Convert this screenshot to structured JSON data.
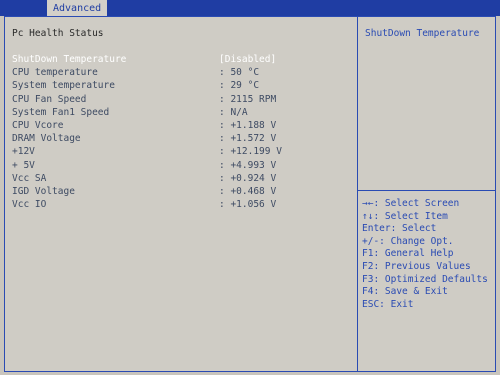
{
  "tabs": {
    "active_label": "Advanced"
  },
  "main": {
    "title": "Pc Health Status",
    "rows": [
      {
        "label": "ShutDown Temperature",
        "value": "[Disabled]"
      },
      {
        "label": "CPU temperature",
        "value": ": 50 °C"
      },
      {
        "label": "System temperature",
        "value": ": 29 °C"
      },
      {
        "label": "CPU Fan Speed",
        "value": ": 2115 RPM"
      },
      {
        "label": "System Fan1 Speed",
        "value": ": N/A"
      },
      {
        "label": "CPU Vcore",
        "value": ": +1.188 V"
      },
      {
        "label": "DRAM Voltage",
        "value": ": +1.572 V"
      },
      {
        "label": "+12V",
        "value": ": +12.199 V"
      },
      {
        "label": "+ 5V",
        "value": ": +4.993 V"
      },
      {
        "label": "Vcc SA",
        "value": ": +0.924 V"
      },
      {
        "label": "IGD Voltage",
        "value": ": +0.468 V"
      },
      {
        "label": "Vcc IO",
        "value": ": +1.056 V"
      }
    ]
  },
  "help": {
    "text": "ShutDown Temperature",
    "keys": [
      "→←: Select Screen",
      "↑↓: Select Item",
      "Enter: Select",
      "+/-: Change Opt.",
      "F1: General Help",
      "F2: Previous Values",
      "F3: Optimized Defaults",
      "F4: Save & Exit",
      "ESC: Exit"
    ]
  },
  "colors": {
    "bar": "#1f3da3",
    "panel": "#cfccc5",
    "label_text": "#3e4b63",
    "selected_text": "#ffffff",
    "help_text": "#2a4bb3"
  }
}
